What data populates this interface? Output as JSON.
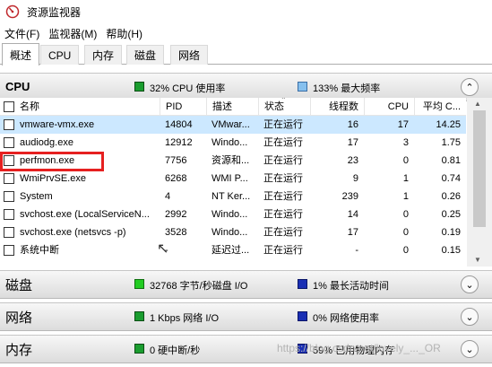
{
  "window": {
    "title": "资源监视器"
  },
  "menu": [
    {
      "label": "文件(F)"
    },
    {
      "label": "监视器(M)"
    },
    {
      "label": "帮助(H)"
    }
  ],
  "tabs": [
    {
      "label": "概述",
      "active": true
    },
    {
      "label": "CPU"
    },
    {
      "label": "内存"
    },
    {
      "label": "磁盘"
    },
    {
      "label": "网络"
    }
  ],
  "cpu": {
    "title": "CPU",
    "usage": "32% CPU 使用率",
    "max_freq": "133% 最大频率",
    "usage_color": "#1a9d2f",
    "freq_color": "#86c0ee",
    "columns": [
      "名称",
      "PID",
      "描述",
      "状态",
      "线程数",
      "CPU",
      "平均 C..."
    ],
    "rows": [
      {
        "name": "vmware-vmx.exe",
        "pid": "14804",
        "desc": "VMwar...",
        "status": "正在运行",
        "threads": "16",
        "cpu": "17",
        "avg": "14.25",
        "selected": true
      },
      {
        "name": "audiodg.exe",
        "pid": "12912",
        "desc": "Windo...",
        "status": "正在运行",
        "threads": "17",
        "cpu": "3",
        "avg": "1.75"
      },
      {
        "name": "perfmon.exe",
        "pid": "7756",
        "desc": "资源和...",
        "status": "正在运行",
        "threads": "23",
        "cpu": "0",
        "avg": "0.81"
      },
      {
        "name": "WmiPrvSE.exe",
        "pid": "6268",
        "desc": "WMI P...",
        "status": "正在运行",
        "threads": "9",
        "cpu": "1",
        "avg": "0.74"
      },
      {
        "name": "System",
        "pid": "4",
        "desc": "NT Ker...",
        "status": "正在运行",
        "threads": "239",
        "cpu": "1",
        "avg": "0.26"
      },
      {
        "name": "svchost.exe (LocalServiceN...",
        "pid": "2992",
        "desc": "Windo...",
        "status": "正在运行",
        "threads": "14",
        "cpu": "0",
        "avg": "0.25"
      },
      {
        "name": "svchost.exe (netsvcs -p)",
        "pid": "3528",
        "desc": "Windo...",
        "status": "正在运行",
        "threads": "17",
        "cpu": "0",
        "avg": "0.19"
      },
      {
        "name": "系统中断",
        "pid": "-",
        "desc": "延迟过...",
        "status": "正在运行",
        "threads": "-",
        "cpu": "0",
        "avg": "0.15"
      }
    ]
  },
  "disk": {
    "title": "磁盘",
    "stat1": "32768 字节/秒磁盘 I/O",
    "stat2": "1% 最长活动时间",
    "color1": "#22cc22",
    "color2": "#1a2fb4"
  },
  "network": {
    "title": "网络",
    "stat1": "1 Kbps 网络 I/O",
    "stat2": "0% 网络使用率",
    "color1": "#1a9d2f",
    "color2": "#1a2fb4"
  },
  "memory": {
    "title": "内存",
    "stat1": "0 硬中断/秒",
    "stat2": "59% 已用物理内存",
    "color1": "#1a9d2f",
    "color2": "#1a2fb4"
  },
  "watermark": "https://blog.csdn.net/lovely_..._OR"
}
